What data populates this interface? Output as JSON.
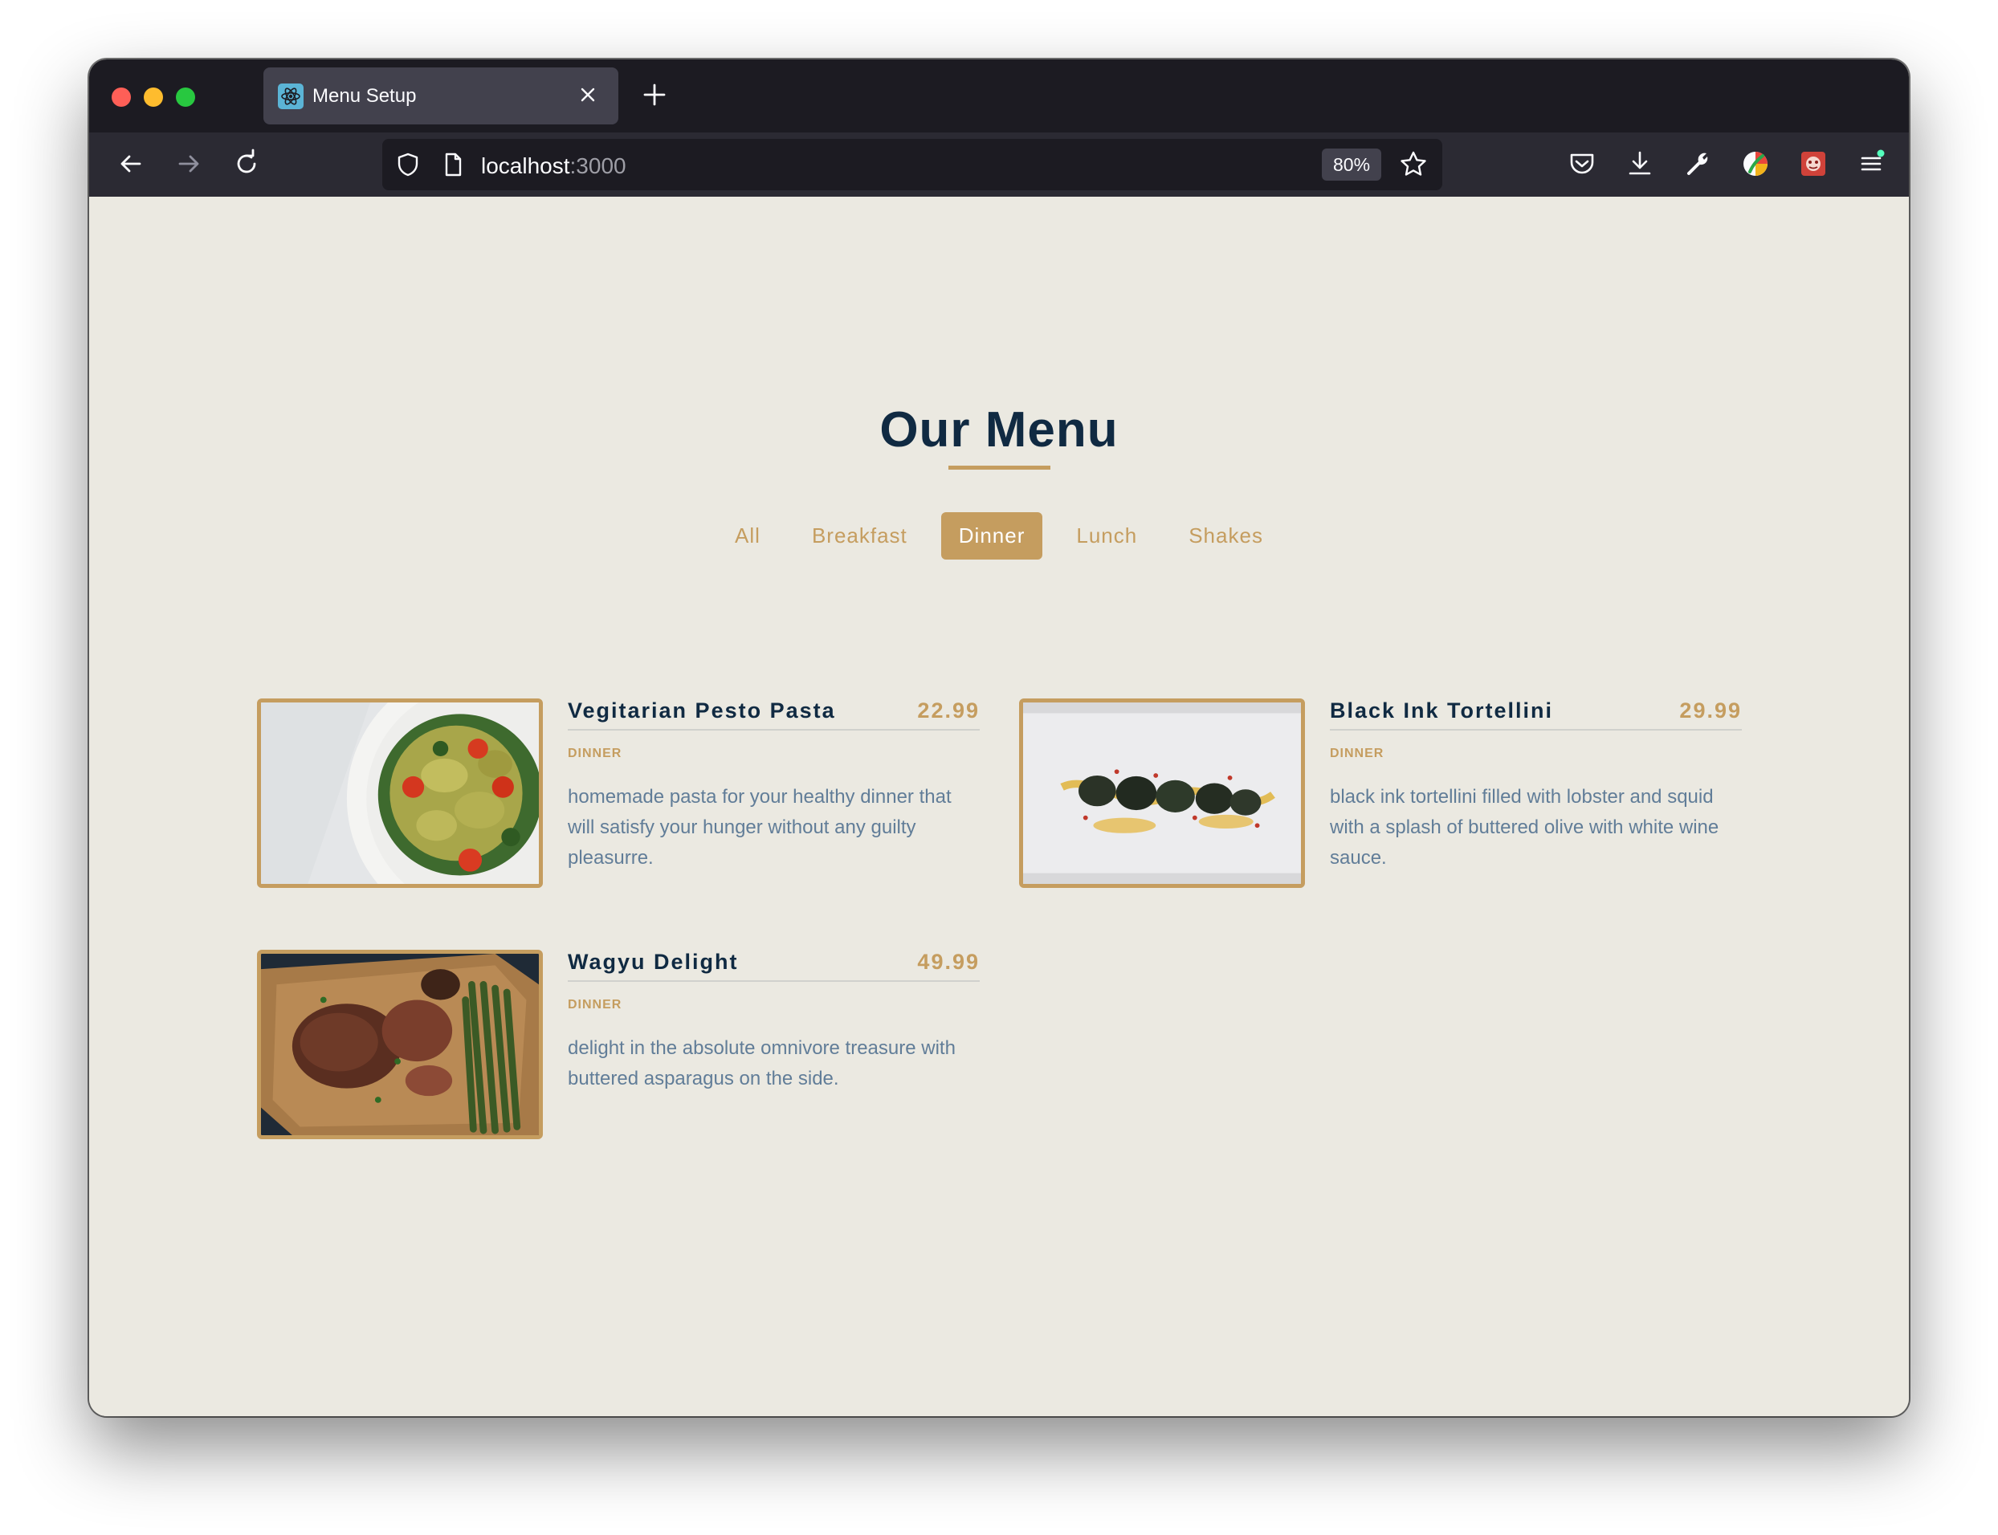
{
  "browser": {
    "tab_title": "Menu Setup",
    "url_host": "localhost",
    "url_port": ":3000",
    "zoom": "80%"
  },
  "page": {
    "title": "Our Menu",
    "filters": [
      "All",
      "Breakfast",
      "Dinner",
      "Lunch",
      "Shakes"
    ],
    "active_filter": "Dinner",
    "items": [
      {
        "name": "Vegitarian Pesto Pasta",
        "price": "22.99",
        "category": "DINNER",
        "description": "homemade pasta for your healthy dinner that will satisfy your hunger without any guilty pleasurre."
      },
      {
        "name": "Black Ink Tortellini",
        "price": "29.99",
        "category": "DINNER",
        "description": "black ink tortellini filled with lobster and squid with a splash of buttered olive with white wine sauce."
      },
      {
        "name": "Wagyu Delight",
        "price": "49.99",
        "category": "DINNER",
        "description": "delight in the absolute omnivore treasure with buttered asparagus on the side."
      }
    ]
  },
  "colors": {
    "accent": "#c59d5f",
    "title": "#102a42",
    "text": "#617d98",
    "background": "#ebe9e1",
    "toolbar": "#2b2a33",
    "tabbar": "#1c1b22"
  }
}
